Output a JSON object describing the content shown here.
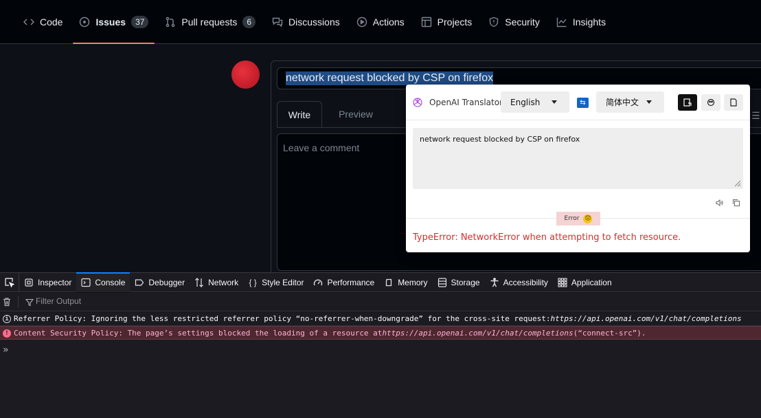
{
  "repo_nav": {
    "tabs": [
      {
        "label": "Code",
        "icon": "code-icon"
      },
      {
        "label": "Issues",
        "icon": "issue-icon",
        "count": "37",
        "selected": true
      },
      {
        "label": "Pull requests",
        "icon": "pull-request-icon",
        "count": "6"
      },
      {
        "label": "Discussions",
        "icon": "discussions-icon"
      },
      {
        "label": "Actions",
        "icon": "play-icon"
      },
      {
        "label": "Projects",
        "icon": "table-icon"
      },
      {
        "label": "Security",
        "icon": "shield-icon"
      },
      {
        "label": "Insights",
        "icon": "graph-icon"
      }
    ]
  },
  "issue_form": {
    "title_value": "network request blocked by CSP on firefox",
    "tab_write": "Write",
    "tab_preview": "Preview",
    "comment_placeholder": "Leave a comment"
  },
  "translator": {
    "brand": "OpenAI Translator",
    "source_lang": "English",
    "target_lang": "简体中文",
    "input_text": "network request blocked by CSP on firefox",
    "status_label": "Error",
    "status_emoji": "😟",
    "error_message": "TypeError: NetworkError when attempting to fetch resource."
  },
  "devtools": {
    "tabs": [
      {
        "label": "Inspector",
        "icon": "inspector-icon"
      },
      {
        "label": "Console",
        "icon": "console-icon",
        "active": true
      },
      {
        "label": "Debugger",
        "icon": "debugger-icon"
      },
      {
        "label": "Network",
        "icon": "network-icon"
      },
      {
        "label": "Style Editor",
        "icon": "braces-icon"
      },
      {
        "label": "Performance",
        "icon": "gauge-icon"
      },
      {
        "label": "Memory",
        "icon": "memory-icon"
      },
      {
        "label": "Storage",
        "icon": "storage-icon"
      },
      {
        "label": "Accessibility",
        "icon": "accessibility-icon"
      },
      {
        "label": "Application",
        "icon": "application-icon"
      }
    ],
    "filter_placeholder": "Filter Output",
    "messages": [
      {
        "level": "info",
        "text": "Referrer Policy: Ignoring the less restricted referrer policy “no-referrer-when-downgrade” for the cross-site request: ",
        "url": "https://api.openai.com/v1/chat/completions",
        "suffix": ""
      },
      {
        "level": "error",
        "text": "Content Security Policy: The page’s settings blocked the loading of a resource at ",
        "url": "https://api.openai.com/v1/chat/completions",
        "suffix": " (“connect-src”)."
      }
    ],
    "prompt_symbol": "»"
  }
}
